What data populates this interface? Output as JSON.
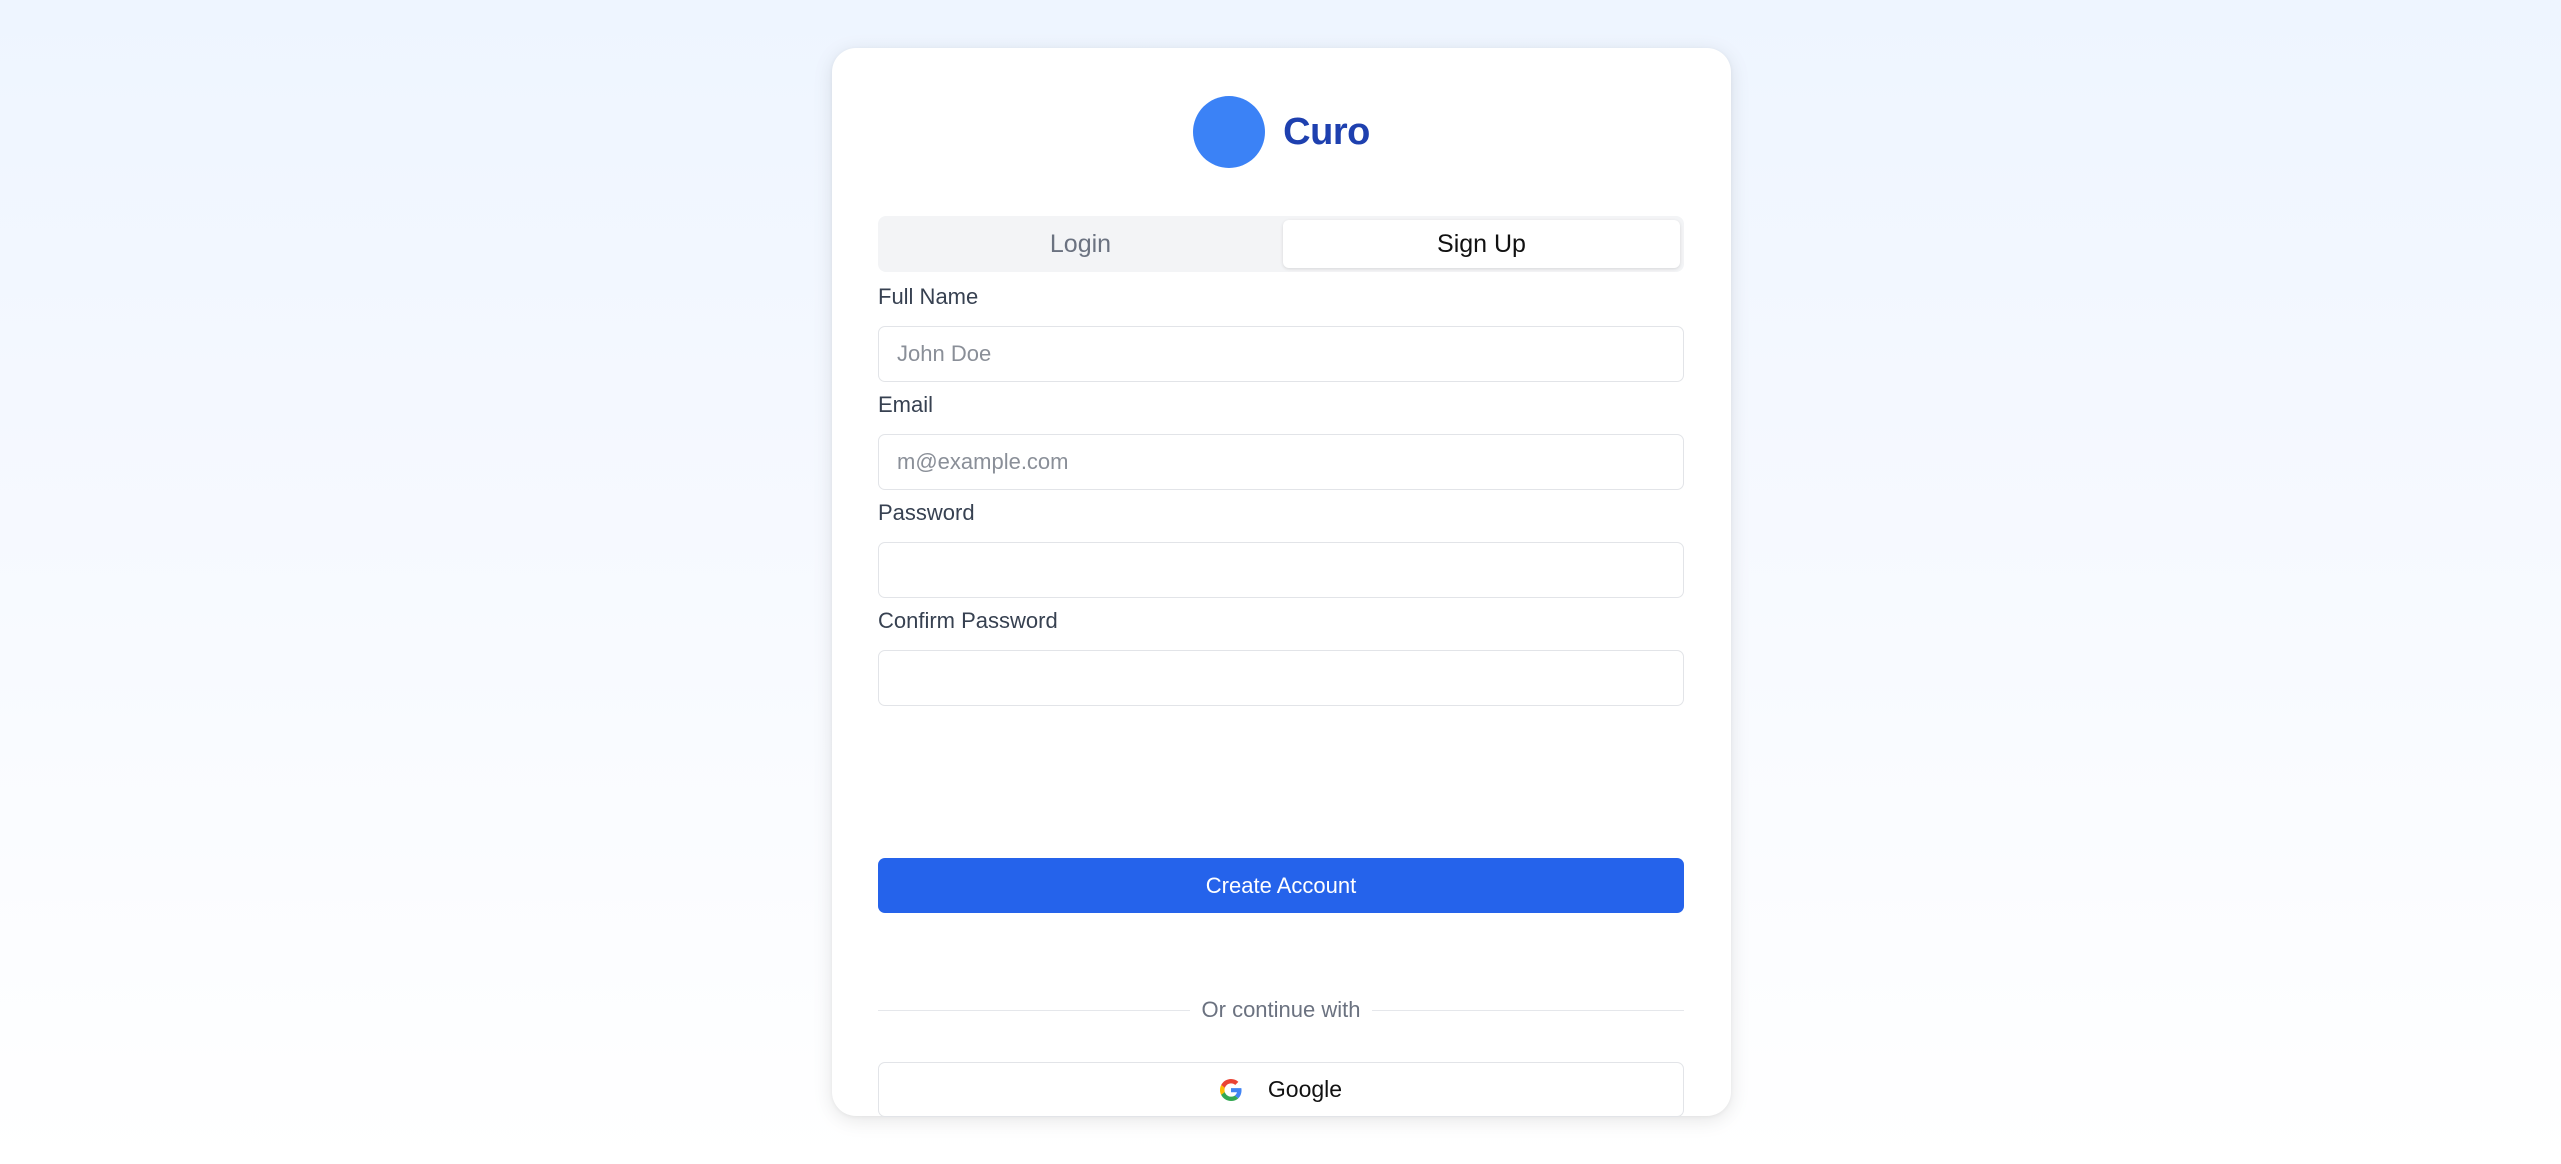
{
  "brand": {
    "name": "Curo",
    "logo_icon": "circle-logo-icon",
    "logo_color": "#3b82f6",
    "name_color": "#1e40af"
  },
  "tabs": [
    {
      "label": "Login",
      "active": false
    },
    {
      "label": "Sign Up",
      "active": true
    }
  ],
  "form": {
    "full_name": {
      "label": "Full Name",
      "placeholder": "John Doe",
      "value": ""
    },
    "email": {
      "label": "Email",
      "placeholder": "m@example.com",
      "value": ""
    },
    "password": {
      "label": "Password",
      "placeholder": "",
      "value": ""
    },
    "confirm_password": {
      "label": "Confirm Password",
      "placeholder": "",
      "value": ""
    },
    "submit_label": "Create Account",
    "submit_color": "#2563eb"
  },
  "divider_text": "Or continue with",
  "oauth": {
    "google_label": "Google",
    "google_icon": "google-icon"
  }
}
